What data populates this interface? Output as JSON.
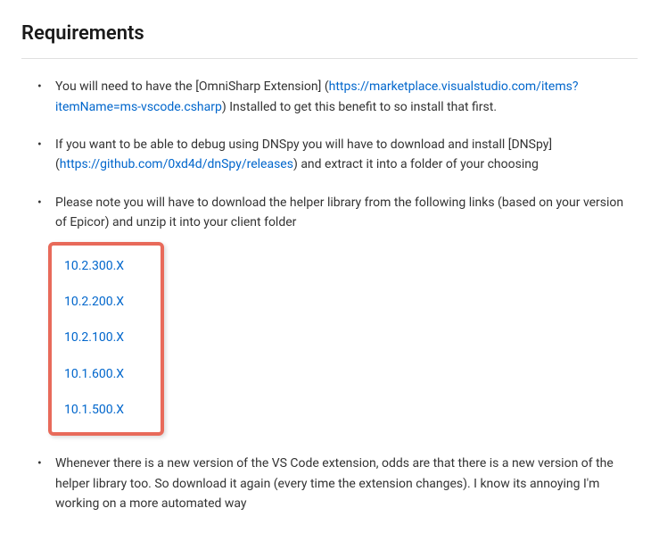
{
  "heading": "Requirements",
  "items": [
    {
      "pre": "You will need to have the [OmniSharp Extension] (",
      "link_text": "https://marketplace.visualstudio.com/items?itemName=ms-vscode.csharp",
      "post": ") Installed to get this benefit to so install that first."
    },
    {
      "pre": "If you want to be able to debug using DNSpy you will have to download and install [DNSpy] (",
      "link_text": "https://github.com/0xd4d/dnSpy/releases",
      "post": ") and extract it into a folder of your choosing"
    },
    {
      "text": "Please note you will have to download the helper library from the following links (based on your version of Epicor) and unzip it into your client folder",
      "versions": [
        "10.2.300.X",
        "10.2.200.X",
        "10.2.100.X",
        "10.1.600.X",
        "10.1.500.X"
      ]
    },
    {
      "text": "Whenever there is a new version of the VS Code extension, odds are that there is a new version of the helper library too. So download it again (every time the extension changes). I know its annoying I'm working on a more automated way"
    }
  ]
}
